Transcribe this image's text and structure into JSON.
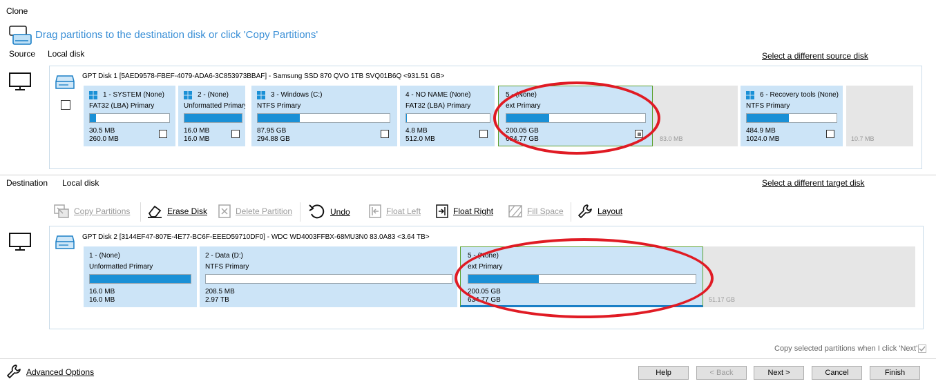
{
  "window": {
    "title": "Clone"
  },
  "header": {
    "instruction": "Drag partitions to the destination disk or click 'Copy Partitions'"
  },
  "source": {
    "label": "Source",
    "disk_type": "Local disk",
    "select_link": "Select a different source disk",
    "disk_title": "GPT Disk 1 [5AED9578-FBEF-4079-ADA6-3C853973BBAF] - Samsung SSD 870 QVO 1TB SVQ01B6Q  <931.51 GB>",
    "partitions": [
      {
        "name": "1 - SYSTEM (None)",
        "type": "FAT32 (LBA) Primary",
        "used": "30.5 MB",
        "total": "260.0 MB",
        "fill": 0.08
      },
      {
        "name": "2 -  (None)",
        "type": "Unformatted Primary",
        "used": "16.0 MB",
        "total": "16.0 MB",
        "fill": 1.0
      },
      {
        "name": "3 - Windows (C:)",
        "type": "NTFS Primary",
        "used": "87.95 GB",
        "total": "294.88 GB",
        "fill": 0.32
      },
      {
        "name": "4 - NO NAME (None)",
        "type": "FAT32 (LBA) Primary",
        "used": "4.8 MB",
        "total": "512.0 MB",
        "fill": 0.01
      },
      {
        "name": "5 -  (None)",
        "type": "ext Primary",
        "used": "200.05 GB",
        "total": "634.77 GB",
        "fill": 0.31
      },
      {
        "name": "6 - Recovery tools (None)",
        "type": "NTFS Primary",
        "used": "484.9 MB",
        "total": "1024.0 MB",
        "fill": 0.47
      }
    ],
    "unallocated": [
      "83.0 MB",
      "10.7 MB"
    ]
  },
  "destination": {
    "label": "Destination",
    "disk_type": "Local disk",
    "select_link": "Select a different target disk",
    "disk_title": "GPT Disk 2 [3144EF47-807E-4E77-BC6F-EEED59710DF0] - WDC WD4003FFBX-68MU3N0 83.0A83  <3.64 TB>",
    "partitions": [
      {
        "name": "1 -  (None)",
        "type": "Unformatted Primary",
        "used": "16.0 MB",
        "total": "16.0 MB",
        "fill": 1.0
      },
      {
        "name": "2 - Data (D:)",
        "type": "NTFS Primary",
        "used": "208.5 MB",
        "total": "2.97 TB",
        "fill": 0.0
      },
      {
        "name": "5 -  (None)",
        "type": "ext Primary",
        "used": "200.05 GB",
        "total": "634.77 GB",
        "fill": 0.31
      }
    ],
    "unallocated": [
      "51.17 GB"
    ]
  },
  "toolbar": {
    "copy_partitions": "Copy Partitions",
    "erase_disk": "Erase Disk",
    "delete_partition": "Delete Partition",
    "undo": "Undo",
    "float_left": "Float Left",
    "float_right": "Float Right",
    "fill_space": "Fill Space",
    "layout": "Layout"
  },
  "footer": {
    "copy_selected": "Copy selected partitions when I click 'Next'",
    "advanced_options": "Advanced Options",
    "help": "Help",
    "back": "< Back",
    "next": "Next >",
    "cancel": "Cancel",
    "finish": "Finish"
  },
  "colors": {
    "accent": "#1a90d6",
    "partition_bg": "#cce4f7",
    "highlight": "#e01b24",
    "selected_border": "#5aa02c"
  }
}
